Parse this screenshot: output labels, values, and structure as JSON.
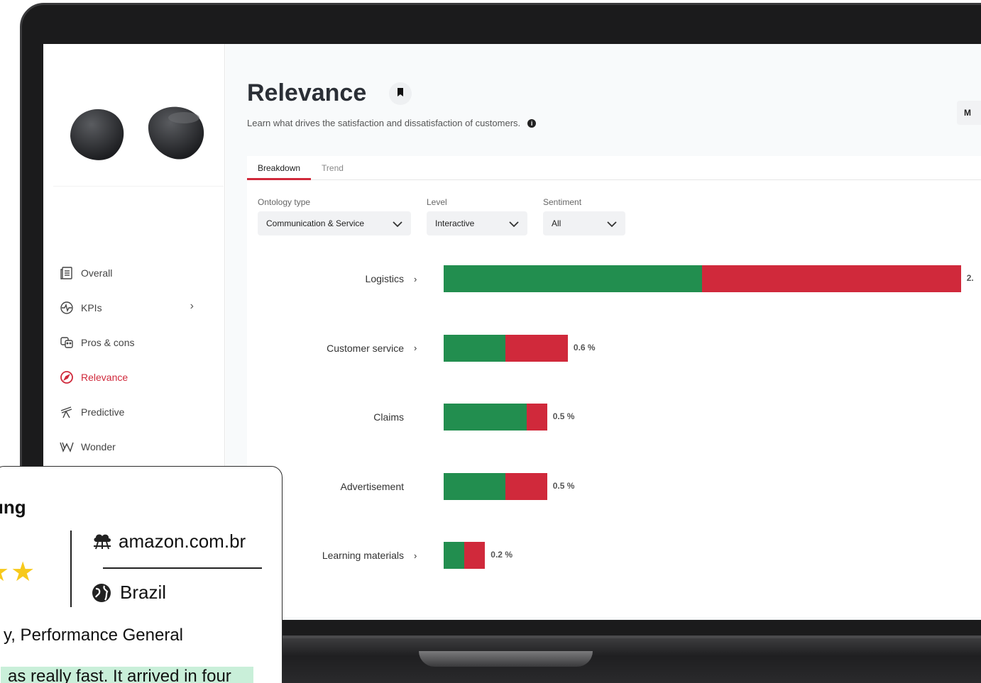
{
  "sidebar": {
    "items": [
      {
        "label": "Overall",
        "icon": "document-list-icon",
        "active": false
      },
      {
        "label": "KPIs",
        "icon": "pulse-icon",
        "active": false,
        "has_chevron": true
      },
      {
        "label": "Pros & cons",
        "icon": "masks-icon",
        "active": false
      },
      {
        "label": "Relevance",
        "icon": "compass-icon",
        "active": true
      },
      {
        "label": "Predictive",
        "icon": "telescope-icon",
        "active": false
      },
      {
        "label": "Wonder",
        "icon": "wonder-icon",
        "active": false
      }
    ]
  },
  "page": {
    "title": "Relevance",
    "subtitle": "Learn what drives the satisfaction and dissatisfaction of customers."
  },
  "tabs": [
    {
      "label": "Breakdown",
      "active": true
    },
    {
      "label": "Trend",
      "active": false
    }
  ],
  "filters": {
    "ontology": {
      "label": "Ontology type",
      "value": "Communication & Service"
    },
    "level": {
      "label": "Level",
      "value": "Interactive"
    },
    "sentiment": {
      "label": "Sentiment",
      "value": "All"
    },
    "more": "M"
  },
  "colors": {
    "positive": "#228e4f",
    "negative": "#d0293b",
    "accent": "#d0293b"
  },
  "chart_data": {
    "type": "bar",
    "orientation": "horizontal",
    "stacked": true,
    "categories": [
      "Logistics",
      "Customer service",
      "Claims",
      "Advertisement",
      "Learning materials"
    ],
    "drilldown": [
      true,
      true,
      false,
      false,
      true
    ],
    "series": [
      {
        "values": [
          1.25,
          0.3,
          0.4,
          0.3,
          0.1
        ]
      },
      {
        "values": [
          1.25,
          0.3,
          0.1,
          0.2,
          0.1
        ]
      }
    ],
    "value_labels": [
      "2.",
      "0.6 %",
      "0.5 %",
      "0.5 %",
      "0.2 %"
    ]
  },
  "review": {
    "brand_fragment": "ung",
    "stars": "★★",
    "source": "amazon.com.br",
    "country": "Brazil",
    "topics": "y, Performance General",
    "quote": "as really fast. It arrived in four"
  }
}
